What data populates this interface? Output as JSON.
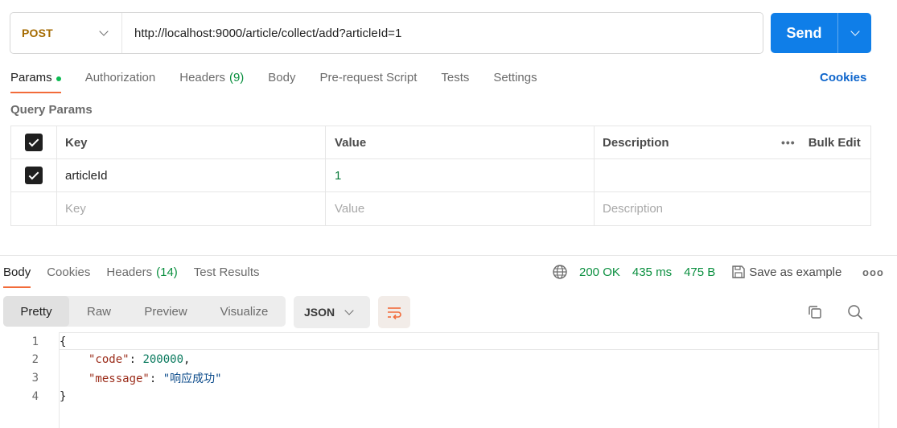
{
  "request": {
    "method": "POST",
    "url": "http://localhost:9000/article/collect/add?articleId=1",
    "send_label": "Send"
  },
  "request_tabs": [
    {
      "label": "Params",
      "indicator": true
    },
    {
      "label": "Authorization"
    },
    {
      "label": "Headers",
      "count": "(9)"
    },
    {
      "label": "Body"
    },
    {
      "label": "Pre-request Script"
    },
    {
      "label": "Tests"
    },
    {
      "label": "Settings"
    }
  ],
  "cookies_link": "Cookies",
  "query_params": {
    "title": "Query Params",
    "headers": {
      "key": "Key",
      "value": "Value",
      "description": "Description",
      "bulk_edit": "Bulk Edit"
    },
    "rows": [
      {
        "checked": true,
        "key": "articleId",
        "value": "1",
        "description": ""
      }
    ],
    "placeholder": {
      "key": "Key",
      "value": "Value",
      "description": "Description"
    }
  },
  "response_tabs": [
    {
      "label": "Body"
    },
    {
      "label": "Cookies"
    },
    {
      "label": "Headers",
      "count": "(14)"
    },
    {
      "label": "Test Results"
    }
  ],
  "response_status": {
    "status": "200 OK",
    "time": "435 ms",
    "size": "475 B",
    "save_label": "Save as example"
  },
  "view_modes": [
    "Pretty",
    "Raw",
    "Preview",
    "Visualize"
  ],
  "format": "JSON",
  "code_lines": [
    {
      "n": "1",
      "text": "{"
    },
    {
      "n": "2",
      "key": "\"code\"",
      "sep": ": ",
      "value": "200000",
      "tail": ","
    },
    {
      "n": "3",
      "key": "\"message\"",
      "sep": ": ",
      "str": "\"响应成功\""
    },
    {
      "n": "4",
      "text": "}"
    }
  ],
  "colors": {
    "accent": "#f26b3a",
    "send_blue": "#0f7ee8",
    "method_post": "#a46a00",
    "status_green": "#0a8f3f"
  }
}
